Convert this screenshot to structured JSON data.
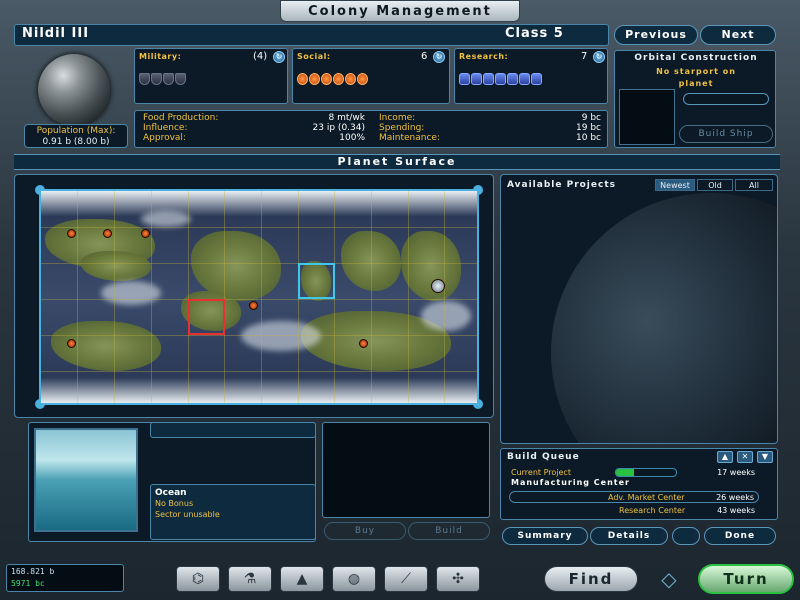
{
  "window": {
    "title": "Colony Management"
  },
  "planet": {
    "name": "Nildil III",
    "class": "Class 5"
  },
  "nav": {
    "previous": "Previous",
    "next": "Next"
  },
  "population": {
    "label": "Population (Max):",
    "value": "0.91 b (8.00 b)"
  },
  "military": {
    "label": "Military:",
    "value": "(4)",
    "pips": 4
  },
  "social": {
    "label": "Social:",
    "value": "6",
    "pips": 6
  },
  "research": {
    "label": "Research:",
    "value": "7",
    "pips": 7
  },
  "economy": {
    "food_label": "Food Production:",
    "food_value": "8 mt/wk",
    "influence_label": "Influence:",
    "influence_value": "23 ip (0.34)",
    "approval_label": "Approval:",
    "approval_value": "100%",
    "income_label": "Income:",
    "income_value": "9 bc",
    "spending_label": "Spending:",
    "spending_value": "19 bc",
    "maintenance_label": "Maintenance:",
    "maintenance_value": "10 bc"
  },
  "orbital": {
    "title": "Orbital Construction",
    "message_line1": "No starport on",
    "message_line2": "planet",
    "build_ship": "Build Ship"
  },
  "surface": {
    "title": "Planet Surface"
  },
  "projects": {
    "title": "Available Projects",
    "tabs": [
      "Newest",
      "Old",
      "All"
    ],
    "active_tab": 0
  },
  "tile": {
    "name": "Ocean",
    "bonus": "No Bonus",
    "status": "Sector unusable"
  },
  "build_actions": {
    "buy": "Buy",
    "build": "Build"
  },
  "queue": {
    "title": "Build Queue",
    "current_label": "Current Project",
    "current_name": "Manufacturing Center",
    "current_weeks": "17 weeks",
    "current_progress": 0.3,
    "items": [
      {
        "name": "Adv. Market Center",
        "weeks": "26 weeks"
      },
      {
        "name": "Research Center",
        "weeks": "43 weeks"
      }
    ]
  },
  "footer": {
    "summary": "Summary",
    "details": "Details",
    "done": "Done"
  },
  "treasury": {
    "population": "168.821 b",
    "credits": "5971 bc"
  },
  "global": {
    "find": "Find",
    "turn": "Turn"
  },
  "colors": {
    "accent": "#4a86aa",
    "highlight": "#f0c040",
    "turn": "#2ac040"
  }
}
